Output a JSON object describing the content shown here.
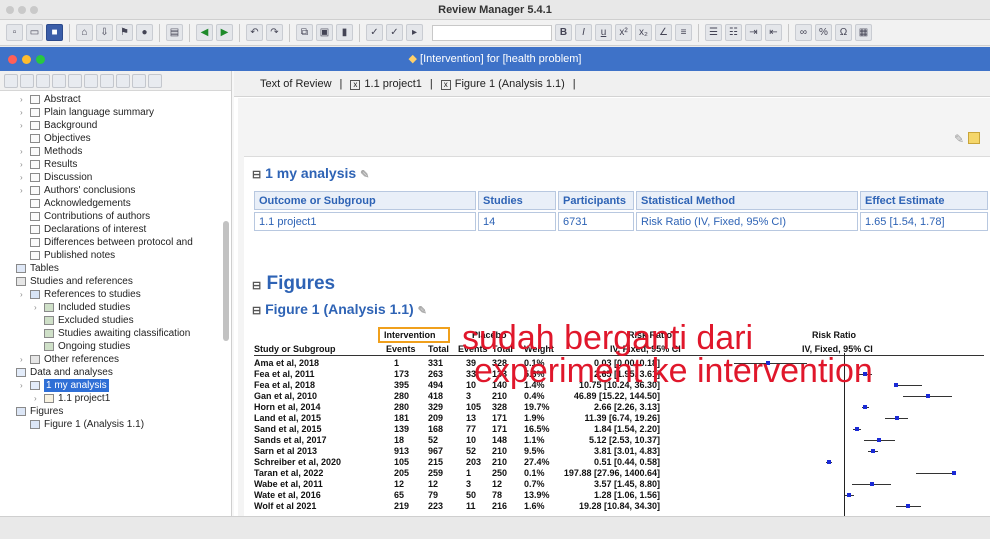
{
  "app_title": "Review Manager 5.4.1",
  "inner_window_title": "[Intervention] for [health problem]",
  "tabs": [
    {
      "label": "Text of Review"
    },
    {
      "label": "1.1 project1"
    },
    {
      "label": "Figure 1 (Analysis 1.1)"
    }
  ],
  "tree": [
    {
      "label": "Abstract",
      "icon": "doc-icon"
    },
    {
      "label": "Plain language summary",
      "icon": "doc-icon"
    },
    {
      "label": "Background",
      "icon": "doc-icon"
    },
    {
      "label": "Objectives",
      "icon": "doc-icon"
    },
    {
      "label": "Methods",
      "icon": "doc-icon"
    },
    {
      "label": "Results",
      "icon": "doc-icon"
    },
    {
      "label": "Discussion",
      "icon": "doc-icon"
    },
    {
      "label": "Authors' conclusions",
      "icon": "doc-icon"
    },
    {
      "label": "Acknowledgements",
      "icon": "doc-icon"
    },
    {
      "label": "Contributions of authors",
      "icon": "doc-icon"
    },
    {
      "label": "Declarations of interest",
      "icon": "doc-icon"
    },
    {
      "label": "Differences between protocol and",
      "icon": "doc-icon"
    },
    {
      "label": "Published notes",
      "icon": "doc-icon"
    },
    {
      "label": "Tables",
      "icon": "table-icon"
    },
    {
      "label": "Studies and references",
      "icon": "book-icon"
    },
    {
      "label": "References to studies",
      "icon": "folder-icon"
    },
    {
      "label": "Included studies",
      "icon": "studies-icon"
    },
    {
      "label": "Excluded studies",
      "icon": "studies-icon"
    },
    {
      "label": "Studies awaiting classification",
      "icon": "studies-icon"
    },
    {
      "label": "Ongoing studies",
      "icon": "studies-icon"
    },
    {
      "label": "Other references",
      "icon": "book-icon"
    },
    {
      "label": "Data and analyses",
      "icon": "chart-icon"
    },
    {
      "label": "1 my analysis",
      "icon": "chart-icon"
    },
    {
      "label": "1.1 project1",
      "icon": "percent-icon"
    },
    {
      "label": "Figures",
      "icon": "figure-icon"
    },
    {
      "label": "Figure 1 (Analysis 1.1)",
      "icon": "figure-icon"
    }
  ],
  "analysis": {
    "heading": "1 my analysis",
    "columns": [
      "Outcome or Subgroup",
      "Studies",
      "Participants",
      "Statistical Method",
      "Effect Estimate"
    ],
    "row": [
      "1.1 project1",
      "14",
      "6731",
      "Risk Ratio (IV, Fixed, 95% CI)",
      "1.65 [1.54, 1.78]"
    ]
  },
  "figures": {
    "heading": "Figures",
    "figure1_heading": "Figure 1 (Analysis 1.1)"
  },
  "forest": {
    "group_intervention": "Intervention",
    "group_placebo": "Placebo",
    "rr_header": "Risk Ratio",
    "rr_sub": "IV, Fixed, 95% CI",
    "rr_header2": "Risk Ratio",
    "rr_sub2": "IV, Fixed, 95% CI",
    "col_study": "Study or Subgroup",
    "col_events": "Events",
    "col_total": "Total",
    "col_events2": "Events",
    "col_total2": "Total",
    "col_weight": "Weight",
    "rows": [
      {
        "study": "Ama et al, 2018",
        "e1": "1",
        "t1": "331",
        "e2": "39",
        "t2": "328",
        "w": "0.1%",
        "rr": "0.03 [0.00, 0.18]"
      },
      {
        "study": "Fea et al, 2011",
        "e1": "173",
        "t1": "263",
        "e2": "33",
        "t2": "133",
        "w": "5.6%",
        "rr": "2.65 [1.95, 3.61]"
      },
      {
        "study": "Fea et al, 2018",
        "e1": "395",
        "t1": "494",
        "e2": "10",
        "t2": "140",
        "w": "1.4%",
        "rr": "10.75 [10.24, 36.30]"
      },
      {
        "study": "Gan et al, 2010",
        "e1": "280",
        "t1": "418",
        "e2": "3",
        "t2": "210",
        "w": "0.4%",
        "rr": "46.89 [15.22, 144.50]"
      },
      {
        "study": "Horn et al, 2014",
        "e1": "280",
        "t1": "329",
        "e2": "105",
        "t2": "328",
        "w": "19.7%",
        "rr": "2.66 [2.26, 3.13]"
      },
      {
        "study": "Land et al, 2015",
        "e1": "181",
        "t1": "209",
        "e2": "13",
        "t2": "171",
        "w": "1.9%",
        "rr": "11.39 [6.74, 19.26]"
      },
      {
        "study": "Sand et al, 2015",
        "e1": "139",
        "t1": "168",
        "e2": "77",
        "t2": "171",
        "w": "16.5%",
        "rr": "1.84 [1.54, 2.20]"
      },
      {
        "study": "Sands et al, 2017",
        "e1": "18",
        "t1": "52",
        "e2": "10",
        "t2": "148",
        "w": "1.1%",
        "rr": "5.12 [2.53, 10.37]"
      },
      {
        "study": "Sarn et al 2013",
        "e1": "913",
        "t1": "967",
        "e2": "52",
        "t2": "210",
        "w": "9.5%",
        "rr": "3.81 [3.01, 4.83]"
      },
      {
        "study": "Schreiber et al, 2020",
        "e1": "105",
        "t1": "215",
        "e2": "203",
        "t2": "210",
        "w": "27.4%",
        "rr": "0.51 [0.44, 0.58]"
      },
      {
        "study": "Taran et al, 2022",
        "e1": "205",
        "t1": "259",
        "e2": "1",
        "t2": "250",
        "w": "0.1%",
        "rr": "197.88 [27.96, 1400.64]"
      },
      {
        "study": "Wabe et al, 2011",
        "e1": "12",
        "t1": "12",
        "e2": "3",
        "t2": "12",
        "w": "0.7%",
        "rr": "3.57 [1.45, 8.80]"
      },
      {
        "study": "Wate et al, 2016",
        "e1": "65",
        "t1": "79",
        "e2": "50",
        "t2": "78",
        "w": "13.9%",
        "rr": "1.28 [1.06, 1.56]"
      },
      {
        "study": "Wolf et al 2021",
        "e1": "219",
        "t1": "223",
        "e2": "11",
        "t2": "216",
        "w": "1.6%",
        "rr": "19.28 [10.84, 34.30]"
      }
    ]
  },
  "annotation": {
    "line1": "sudah berganti dari",
    "line2": "experiment ke intervention",
    "color": "#e0172b",
    "box_color": "#f0a01c"
  },
  "colors": {
    "accent": "#3e72c8",
    "heading": "#2e63b5",
    "selection": "#2f6fd6"
  }
}
